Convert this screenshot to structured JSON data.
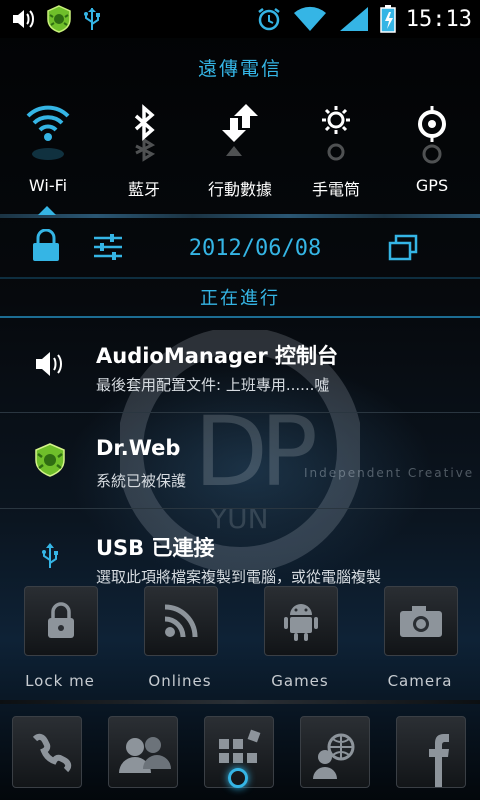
{
  "status_bar": {
    "time": "15:13",
    "left_icons": [
      "volume-icon",
      "drweb-shield-icon",
      "usb-icon"
    ],
    "right_icons": [
      "alarm-icon",
      "wifi-signal-icon",
      "cell-signal-icon",
      "battery-charging-icon"
    ]
  },
  "panel": {
    "carrier": "遠傳電信",
    "toggles": [
      {
        "label": "Wi-Fi",
        "icon": "wifi-icon",
        "active": true
      },
      {
        "label": "藍牙",
        "icon": "bluetooth-icon",
        "active": false
      },
      {
        "label": "行動數據",
        "icon": "mobile-data-icon",
        "active": false
      },
      {
        "label": "手電筒",
        "icon": "flashlight-icon",
        "active": false
      },
      {
        "label": "GPS",
        "icon": "gps-icon",
        "active": false
      }
    ],
    "date": "2012/06/08",
    "ongoing_header": "正在進行",
    "accent": "#35b5e5"
  },
  "notifications": [
    {
      "title": "AudioManager 控制台",
      "text": "最後套用配置文件: 上班專用......噓",
      "icon": "volume-icon"
    },
    {
      "title": "Dr.Web",
      "text": "系統已被保護",
      "icon": "drweb-shield-icon"
    },
    {
      "title": "USB 已連接",
      "text": "選取此項將檔案複製到電腦，或從電腦複製",
      "icon": "usb-icon"
    }
  ],
  "home": {
    "watermark_text": "Independent Creative",
    "dock": [
      {
        "label": "Lock me",
        "icon": "lock-icon"
      },
      {
        "label": "Onlines",
        "icon": "rss-icon"
      },
      {
        "label": "Games",
        "icon": "android-icon"
      },
      {
        "label": "Camera",
        "icon": "camera-icon"
      }
    ],
    "bottom_bar": [
      "phone-icon",
      "contacts-icon",
      "apps-grid-icon",
      "browser-icon",
      "facebook-icon"
    ]
  }
}
